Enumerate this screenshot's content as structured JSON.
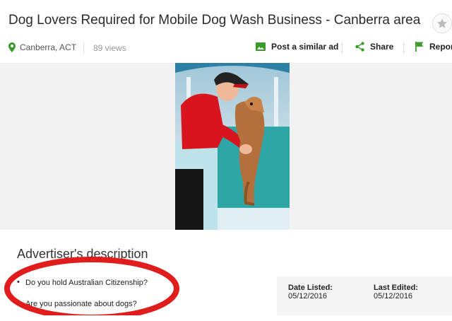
{
  "listing": {
    "title": "Dog Lovers Required for Mobile Dog Wash Business - Canberra area",
    "location": "Canberra, ACT",
    "views": "89 views"
  },
  "actions": {
    "post_similar": "Post a similar ad",
    "share": "Share",
    "report": "Report"
  },
  "description": {
    "heading": "Advertiser's description",
    "items": [
      "Do you hold Australian Citizenship?",
      "Are you passionate about dogs?"
    ]
  },
  "details": {
    "date_listed_label": "Date Listed:",
    "date_listed": "05/12/2016",
    "last_edited_label": "Last Edited:",
    "last_edited": "05/12/2016"
  },
  "icons": {
    "favourite": "star-icon",
    "location": "map-pin-icon",
    "post_similar": "image-icon",
    "share": "share-icon",
    "report": "flag-icon"
  },
  "colors": {
    "accent_green": "#3a9b2a",
    "annotation_red": "#e11c1c"
  }
}
